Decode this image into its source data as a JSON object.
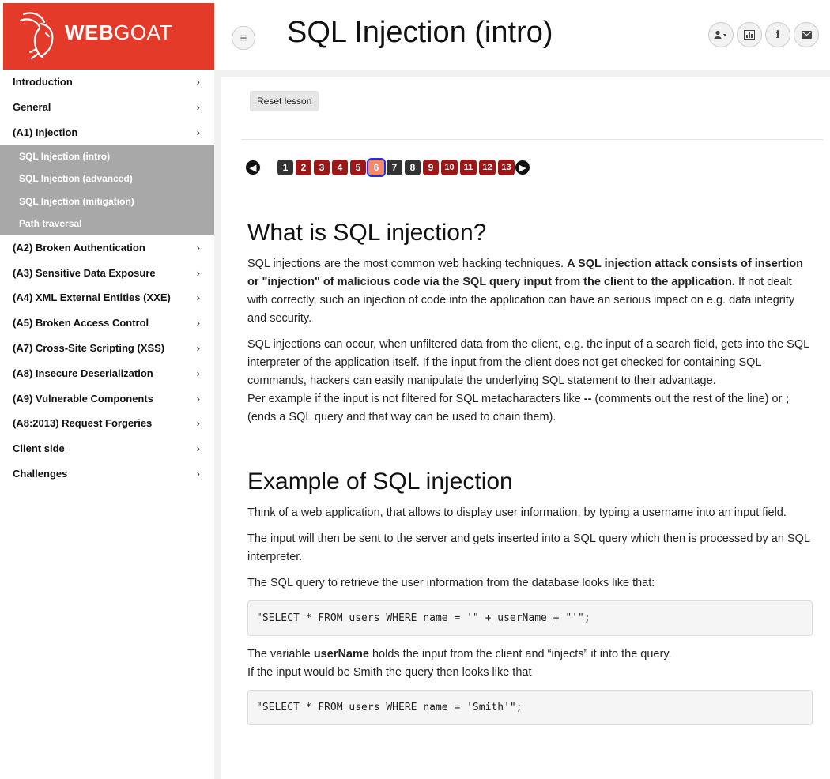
{
  "brand": {
    "strong": "WEB",
    "light": "GOAT"
  },
  "header": {
    "title": "SQL Injection (intro)",
    "buttons": [
      {
        "name": "user-menu",
        "icon": "user-icon"
      },
      {
        "name": "report-card",
        "icon": "chart-icon"
      },
      {
        "name": "about",
        "icon": "info-icon"
      },
      {
        "name": "messages",
        "icon": "envelope-icon"
      }
    ]
  },
  "sidebar": {
    "items_top": [
      {
        "label": "Introduction",
        "chev": "›"
      },
      {
        "label": "General",
        "chev": "›"
      },
      {
        "label": "(A1) Injection",
        "chev": "›"
      }
    ],
    "subitems": [
      {
        "label": "SQL Injection (intro)"
      },
      {
        "label": "SQL Injection (advanced)"
      },
      {
        "label": "SQL Injection (mitigation)"
      },
      {
        "label": "Path traversal"
      }
    ],
    "items_bottom": [
      {
        "label": "(A2) Broken Authentication",
        "chev": "›"
      },
      {
        "label": "(A3) Sensitive Data Exposure",
        "chev": "›"
      },
      {
        "label": "(A4) XML External Entities (XXE)",
        "chev": "›"
      },
      {
        "label": "(A5) Broken Access Control",
        "chev": "›"
      },
      {
        "label": "(A7) Cross-Site Scripting (XSS)",
        "chev": "›"
      },
      {
        "label": "(A8) Insecure Deserialization",
        "chev": "›"
      },
      {
        "label": "(A9) Vulnerable Components",
        "chev": "›"
      },
      {
        "label": "(A8:2013) Request Forgeries",
        "chev": "›"
      },
      {
        "label": "Client side",
        "chev": "›"
      },
      {
        "label": "Challenges",
        "chev": "›"
      }
    ]
  },
  "lesson": {
    "reset_label": "Reset lesson",
    "pages": [
      {
        "num": "1",
        "state": "dark"
      },
      {
        "num": "2",
        "state": "red"
      },
      {
        "num": "3",
        "state": "red"
      },
      {
        "num": "4",
        "state": "red"
      },
      {
        "num": "5",
        "state": "red"
      },
      {
        "num": "6",
        "state": "cur"
      },
      {
        "num": "7",
        "state": "dark"
      },
      {
        "num": "8",
        "state": "dark"
      },
      {
        "num": "9",
        "state": "red"
      },
      {
        "num": "10",
        "state": "red"
      },
      {
        "num": "11",
        "state": "red"
      },
      {
        "num": "12",
        "state": "red"
      },
      {
        "num": "13",
        "state": "red"
      }
    ]
  },
  "article": {
    "h1": "What is SQL injection?",
    "p1_a": "SQL injections are the most common web hacking techniques. ",
    "p1_b": "A SQL injection attack consists of insertion or \"injection\" of malicious code via the SQL query input from the client to the application.",
    "p1_c": " If not dealt with correctly, such an injection of code into the application can have an serious impact on e.g. data integrity and security.",
    "p2": "SQL injections can occur, when unfiltered data from the client, e.g. the input of a search field, gets into the SQL interpreter of the application itself. If the input from the client does not get checked for containing SQL commands, hackers can easily manipulate the underlying SQL statement to their advantage.",
    "p3_a": "Per example if the input is not filtered for SQL metacharacters like ",
    "p3_b": "--",
    "p3_c": " (comments out the rest of the line) or ",
    "p3_d": ";",
    "p3_e": " (ends a SQL query and that way can be used to chain them).",
    "h2": "Example of SQL injection",
    "p4": "Think of a web application, that allows to display user information, by typing a username into an input field.",
    "p5": "The input will then be sent to the server and gets inserted into a SQL query which then is processed by an SQL interpreter.",
    "p6": "The SQL query to retrieve the user information from the database looks like that:",
    "code1": "\"SELECT * FROM users WHERE name = '\" + userName + \"'\";",
    "p7_a": "The variable ",
    "p7_b": "userName",
    "p7_c": " holds the input from the client and “injects” it into the query.",
    "p8": "If the input would be Smith the query then looks like that",
    "code2": "\"SELECT * FROM users WHERE name = 'Smith'\";"
  }
}
